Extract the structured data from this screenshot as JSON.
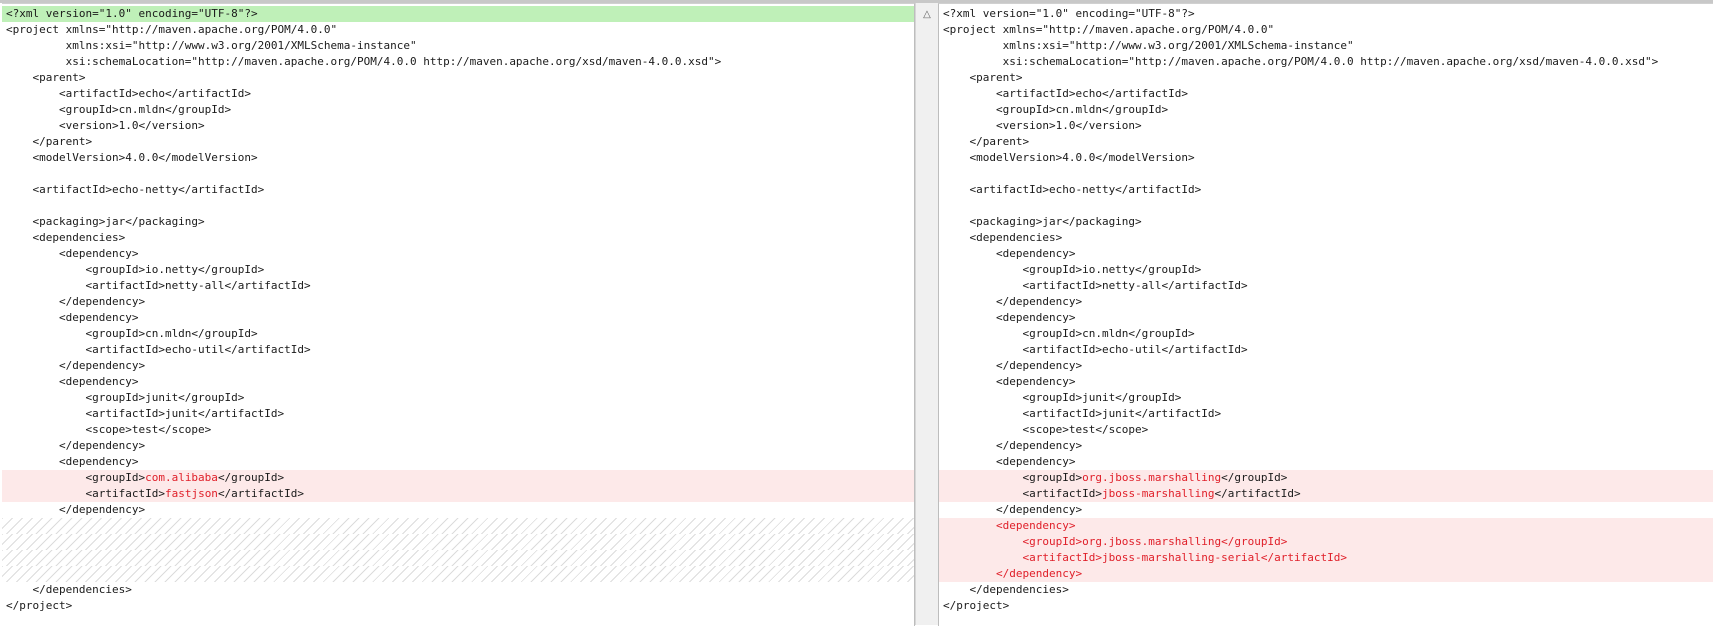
{
  "left_pane": {
    "lines": [
      {
        "type": "current",
        "text": "<?xml version=\"1.0\" encoding=\"UTF-8\"?>"
      },
      {
        "type": "normal",
        "text": "<project xmlns=\"http://maven.apache.org/POM/4.0.0\""
      },
      {
        "type": "normal",
        "text": "         xmlns:xsi=\"http://www.w3.org/2001/XMLSchema-instance\""
      },
      {
        "type": "normal",
        "text": "         xsi:schemaLocation=\"http://maven.apache.org/POM/4.0.0 http://maven.apache.org/xsd/maven-4.0.0.xsd\">"
      },
      {
        "type": "normal",
        "text": "    <parent>"
      },
      {
        "type": "normal",
        "text": "        <artifactId>echo</artifactId>"
      },
      {
        "type": "normal",
        "text": "        <groupId>cn.mldn</groupId>"
      },
      {
        "type": "normal",
        "text": "        <version>1.0</version>"
      },
      {
        "type": "normal",
        "text": "    </parent>"
      },
      {
        "type": "normal",
        "text": "    <modelVersion>4.0.0</modelVersion>"
      },
      {
        "type": "normal",
        "text": ""
      },
      {
        "type": "normal",
        "text": "    <artifactId>echo-netty</artifactId>"
      },
      {
        "type": "normal",
        "text": ""
      },
      {
        "type": "normal",
        "text": "    <packaging>jar</packaging>"
      },
      {
        "type": "normal",
        "text": "    <dependencies>"
      },
      {
        "type": "normal",
        "text": "        <dependency>"
      },
      {
        "type": "normal",
        "text": "            <groupId>io.netty</groupId>"
      },
      {
        "type": "normal",
        "text": "            <artifactId>netty-all</artifactId>"
      },
      {
        "type": "normal",
        "text": "        </dependency>"
      },
      {
        "type": "normal",
        "text": "        <dependency>"
      },
      {
        "type": "normal",
        "text": "            <groupId>cn.mldn</groupId>"
      },
      {
        "type": "normal",
        "text": "            <artifactId>echo-util</artifactId>"
      },
      {
        "type": "normal",
        "text": "        </dependency>"
      },
      {
        "type": "normal",
        "text": "        <dependency>"
      },
      {
        "type": "normal",
        "text": "            <groupId>junit</groupId>"
      },
      {
        "type": "normal",
        "text": "            <artifactId>junit</artifactId>"
      },
      {
        "type": "normal",
        "text": "            <scope>test</scope>"
      },
      {
        "type": "normal",
        "text": "        </dependency>"
      },
      {
        "type": "normal",
        "text": "        <dependency>"
      },
      {
        "type": "changed",
        "segments": [
          {
            "t": "            <groupId>",
            "d": false
          },
          {
            "t": "com.alibaba",
            "d": true
          },
          {
            "t": "</groupId>",
            "d": false
          }
        ]
      },
      {
        "type": "changed",
        "segments": [
          {
            "t": "            <artifactId>",
            "d": false
          },
          {
            "t": "fastjson",
            "d": true
          },
          {
            "t": "</artifactId>",
            "d": false
          }
        ]
      },
      {
        "type": "normal",
        "text": "        </dependency>"
      },
      {
        "type": "placeholder",
        "text": ""
      },
      {
        "type": "placeholder",
        "text": ""
      },
      {
        "type": "placeholder",
        "text": ""
      },
      {
        "type": "placeholder",
        "text": ""
      },
      {
        "type": "normal",
        "text": "    </dependencies>"
      },
      {
        "type": "normal",
        "text": "</project>"
      }
    ]
  },
  "right_pane": {
    "lines": [
      {
        "type": "normal",
        "text": "<?xml version=\"1.0\" encoding=\"UTF-8\"?>"
      },
      {
        "type": "normal",
        "text": "<project xmlns=\"http://maven.apache.org/POM/4.0.0\""
      },
      {
        "type": "normal",
        "text": "         xmlns:xsi=\"http://www.w3.org/2001/XMLSchema-instance\""
      },
      {
        "type": "normal",
        "text": "         xsi:schemaLocation=\"http://maven.apache.org/POM/4.0.0 http://maven.apache.org/xsd/maven-4.0.0.xsd\">"
      },
      {
        "type": "normal",
        "text": "    <parent>"
      },
      {
        "type": "normal",
        "text": "        <artifactId>echo</artifactId>"
      },
      {
        "type": "normal",
        "text": "        <groupId>cn.mldn</groupId>"
      },
      {
        "type": "normal",
        "text": "        <version>1.0</version>"
      },
      {
        "type": "normal",
        "text": "    </parent>"
      },
      {
        "type": "normal",
        "text": "    <modelVersion>4.0.0</modelVersion>"
      },
      {
        "type": "normal",
        "text": ""
      },
      {
        "type": "normal",
        "text": "    <artifactId>echo-netty</artifactId>"
      },
      {
        "type": "normal",
        "text": ""
      },
      {
        "type": "normal",
        "text": "    <packaging>jar</packaging>"
      },
      {
        "type": "normal",
        "text": "    <dependencies>"
      },
      {
        "type": "normal",
        "text": "        <dependency>"
      },
      {
        "type": "normal",
        "text": "            <groupId>io.netty</groupId>"
      },
      {
        "type": "normal",
        "text": "            <artifactId>netty-all</artifactId>"
      },
      {
        "type": "normal",
        "text": "        </dependency>"
      },
      {
        "type": "normal",
        "text": "        <dependency>"
      },
      {
        "type": "normal",
        "text": "            <groupId>cn.mldn</groupId>"
      },
      {
        "type": "normal",
        "text": "            <artifactId>echo-util</artifactId>"
      },
      {
        "type": "normal",
        "text": "        </dependency>"
      },
      {
        "type": "normal",
        "text": "        <dependency>"
      },
      {
        "type": "normal",
        "text": "            <groupId>junit</groupId>"
      },
      {
        "type": "normal",
        "text": "            <artifactId>junit</artifactId>"
      },
      {
        "type": "normal",
        "text": "            <scope>test</scope>"
      },
      {
        "type": "normal",
        "text": "        </dependency>"
      },
      {
        "type": "normal",
        "text": "        <dependency>"
      },
      {
        "type": "changed",
        "segments": [
          {
            "t": "            <groupId>",
            "d": false
          },
          {
            "t": "org.jboss.marshalling",
            "d": true
          },
          {
            "t": "</groupId>",
            "d": false
          }
        ]
      },
      {
        "type": "changed",
        "segments": [
          {
            "t": "            <artifactId>",
            "d": false
          },
          {
            "t": "jboss-marshalling",
            "d": true
          },
          {
            "t": "</artifactId>",
            "d": false
          }
        ]
      },
      {
        "type": "normal",
        "text": "        </dependency>"
      },
      {
        "type": "changed-all",
        "text": "        <dependency>"
      },
      {
        "type": "changed-all",
        "text": "            <groupId>org.jboss.marshalling</groupId>"
      },
      {
        "type": "changed-all",
        "text": "            <artifactId>jboss-marshalling-serial</artifactId>"
      },
      {
        "type": "changed-all",
        "text": "        </dependency>"
      },
      {
        "type": "normal",
        "text": "    </dependencies>"
      },
      {
        "type": "normal",
        "text": "</project>"
      }
    ]
  },
  "scrollbar": {
    "up_arrow_icon": "△"
  }
}
